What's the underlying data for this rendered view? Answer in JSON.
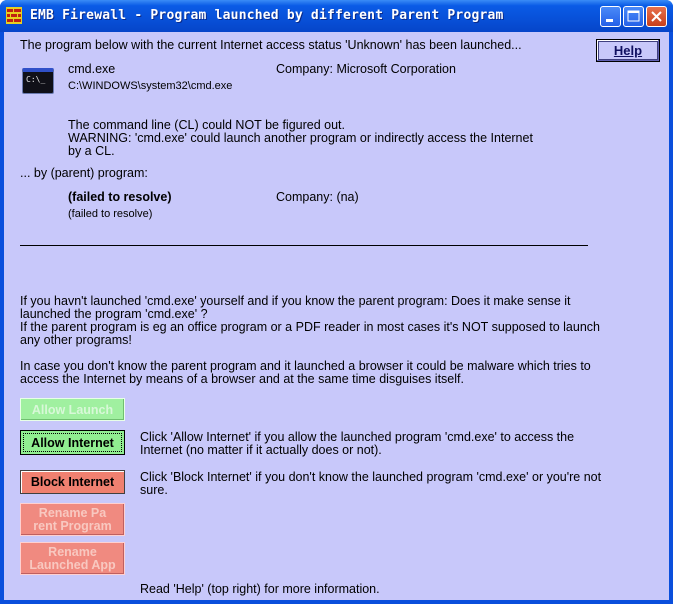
{
  "window": {
    "title": "EMB Firewall - Program launched by different Parent Program"
  },
  "help_button": "Help",
  "intro": "The program below with the current Internet access status 'Unknown' has been launched...",
  "launched": {
    "name": "cmd.exe",
    "path": "C:\\WINDOWS\\system32\\cmd.exe",
    "company": "Company: Microsoft Corporation",
    "icon": "cmd-prompt-icon",
    "icon_text": "C:\\_"
  },
  "warning": {
    "line1": "The command line (CL) could NOT be figured out.",
    "line2": "WARNING: 'cmd.exe' could launch another program or indirectly access the Internet",
    "line3": "by a CL."
  },
  "parent_label": "... by (parent) program:",
  "parent": {
    "name": "(failed to resolve)",
    "path": "(failed to resolve)",
    "company": "Company: (na)"
  },
  "question": {
    "line1": "If you havn't launched 'cmd.exe' yourself and if you know the parent program: Does it make sense it",
    "line2": "launched the program 'cmd.exe' ?",
    "line3": "If the parent program is eg an office program or a PDF reader in most cases it's NOT supposed to launch",
    "line4": "any other programs!",
    "line5": "In case you don't know the parent program and it launched a browser it could be malware which tries to",
    "line6": "access the Internet by means of a browser and at the same time disguises itself."
  },
  "buttons": {
    "allow_launch": "Allow Launch",
    "allow_internet": "Allow Internet",
    "block_internet": "Block Internet",
    "rename_parent_1": "Rename Pa",
    "rename_parent_2": "rent Program",
    "rename_launched_1": "Rename",
    "rename_launched_2": "Launched App"
  },
  "hints": {
    "allow_1": "Click 'Allow Internet' if you allow the launched program 'cmd.exe' to access the",
    "allow_2": "Internet (no matter if it actually does or not).",
    "block_1": "Click 'Block Internet' if you don't know the launched program 'cmd.exe' or you're not",
    "block_2": "sure."
  },
  "footer": "Read 'Help' (top right) for more information.",
  "colors": {
    "background": "#c8c8fa",
    "titlebar": "#0a50d8",
    "allow": "#90ee90",
    "block": "#f08070"
  }
}
